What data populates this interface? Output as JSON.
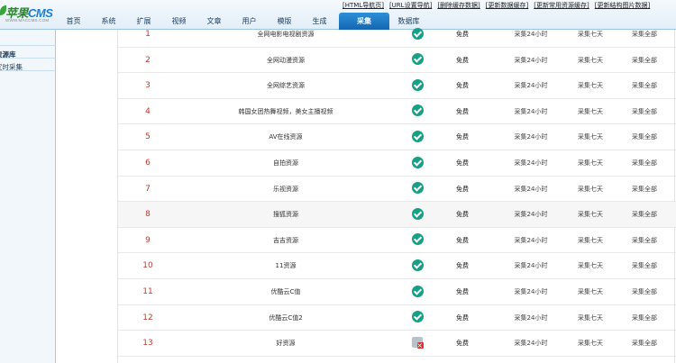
{
  "app": {
    "logo_main": "苹果",
    "logo_accent": "CMS",
    "logo_url": "WWW.MACCMS.COM"
  },
  "toplinks": [
    "[HTML导航页]",
    "[URL设置导航]",
    "[删除缓存数据]",
    "[更新数据缓存]",
    "[更新常用资源缓存]",
    "[更新结构图片数据]"
  ],
  "nav": [
    {
      "label": "首页"
    },
    {
      "label": "系统"
    },
    {
      "label": "扩展"
    },
    {
      "label": "视频"
    },
    {
      "label": "文章"
    },
    {
      "label": "用户"
    },
    {
      "label": "模版"
    },
    {
      "label": "生成"
    },
    {
      "label": "采集",
      "active": true
    },
    {
      "label": "数据库"
    }
  ],
  "sidebar": {
    "items": [
      "资源库",
      "定时采集"
    ]
  },
  "table": {
    "status_ok": "ok-icon",
    "status_bad": "error-icon",
    "rows": [
      {
        "id": "1",
        "name": "全网电影电视剧资源",
        "status": "ok",
        "fee": "免费",
        "t24": "采集24小时",
        "t7": "采集七天",
        "all": "采集全部"
      },
      {
        "id": "2",
        "name": "全网动漫资源",
        "status": "ok",
        "fee": "免费",
        "t24": "采集24小时",
        "t7": "采集七天",
        "all": "采集全部"
      },
      {
        "id": "3",
        "name": "全网综艺资源",
        "status": "ok",
        "fee": "免费",
        "t24": "采集24小时",
        "t7": "采集七天",
        "all": "采集全部"
      },
      {
        "id": "4",
        "name": "韩国女团热舞视频，美女主播视频",
        "status": "ok",
        "fee": "免费",
        "t24": "采集24小时",
        "t7": "采集七天",
        "all": "采集全部"
      },
      {
        "id": "5",
        "name": "AV在线资源",
        "status": "ok",
        "fee": "免费",
        "t24": "采集24小时",
        "t7": "采集七天",
        "all": "采集全部"
      },
      {
        "id": "6",
        "name": "自拍资源",
        "status": "ok",
        "fee": "免费",
        "t24": "采集24小时",
        "t7": "采集七天",
        "all": "采集全部"
      },
      {
        "id": "7",
        "name": "乐视资源",
        "status": "ok",
        "fee": "免费",
        "t24": "采集24小时",
        "t7": "采集七天",
        "all": "采集全部"
      },
      {
        "id": "8",
        "name": "搜狐资源",
        "status": "ok",
        "fee": "免费",
        "t24": "采集24小时",
        "t7": "采集七天",
        "all": "采集全部"
      },
      {
        "id": "9",
        "name": "吉吉资源",
        "status": "ok",
        "fee": "免费",
        "t24": "采集24小时",
        "t7": "采集七天",
        "all": "采集全部"
      },
      {
        "id": "10",
        "name": "11资源",
        "status": "ok",
        "fee": "免费",
        "t24": "采集24小时",
        "t7": "采集七天",
        "all": "采集全部"
      },
      {
        "id": "11",
        "name": "优酷云C值",
        "status": "ok",
        "fee": "免费",
        "t24": "采集24小时",
        "t7": "采集七天",
        "all": "采集全部"
      },
      {
        "id": "12",
        "name": "优酷云C值2",
        "status": "ok",
        "fee": "免费",
        "t24": "采集24小时",
        "t7": "采集七天",
        "all": "采集全部"
      },
      {
        "id": "13",
        "name": "好资源",
        "status": "bad",
        "fee": "免费",
        "t24": "采集24小时",
        "t7": "采集七天",
        "all": "采集全部"
      }
    ]
  }
}
